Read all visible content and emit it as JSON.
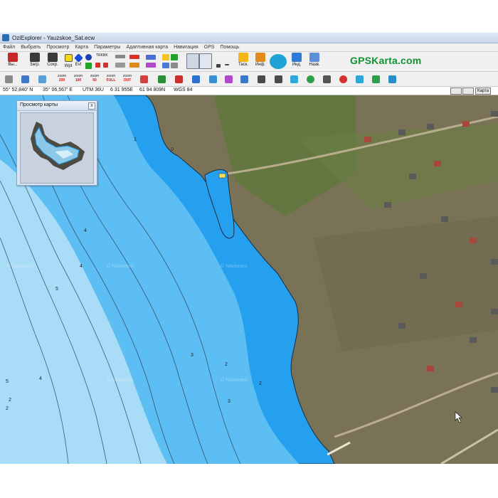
{
  "window": {
    "title": "OziExplorer - Yauzskoe_Sat.ecw"
  },
  "menu": [
    "Файл",
    "Выбрать",
    "Просмотр",
    "Карта",
    "Параметры",
    "Адаптивная карта",
    "Навигация",
    "GPS",
    "Помощь"
  ],
  "toolbar": {
    "buttons": [
      {
        "label": "Вы...",
        "icon": "exit-icon"
      },
      {
        "label": "Загр.",
        "icon": "load-icon"
      },
      {
        "label": "Сохр.",
        "icon": "save-icon"
      },
      {
        "label": "Wpt",
        "icon": "waypoint-icon"
      },
      {
        "label": "Evt",
        "icon": "event-icon"
      },
      {
        "label": "Таск.",
        "icon": "lock-icon"
      },
      {
        "label": "Инф.",
        "icon": "info-icon"
      },
      {
        "label": "Инд.",
        "icon": "index-icon"
      },
      {
        "label": "Назв.",
        "icon": "names-icon"
      }
    ],
    "track_label": "TRKBK",
    "zoom_value": "100"
  },
  "brand": "GPSKarta.com",
  "zoom_buttons": [
    {
      "top": "zoom",
      "bottom": "200"
    },
    {
      "top": "zoom",
      "bottom": "100"
    },
    {
      "top": "zoom",
      "bottom": "50"
    },
    {
      "top": "zoom",
      "bottom": "FULL"
    },
    {
      "top": "zoom",
      "bottom": "OUT"
    }
  ],
  "status": {
    "lat": "55° 52,840' N",
    "lon": "35° 06,567' E",
    "utm": "UTM  36U",
    "east": "6 31 955E",
    "north": "61 94 809N",
    "datum": "WGS 84",
    "map_button": "Карта"
  },
  "preview": {
    "title": "Просмотр карты",
    "close": "x"
  },
  "map": {
    "depth_labels": [
      "1",
      "0",
      "4",
      "4",
      "5",
      "3",
      "2",
      "2",
      "4",
      "2",
      "3",
      "5",
      "2"
    ],
    "watermark": "© Navionics",
    "colors": {
      "shallow": "#24a0ee",
      "mid": "#5cbef2",
      "deep": "#a8dcf7",
      "land": "#7a7256"
    }
  }
}
